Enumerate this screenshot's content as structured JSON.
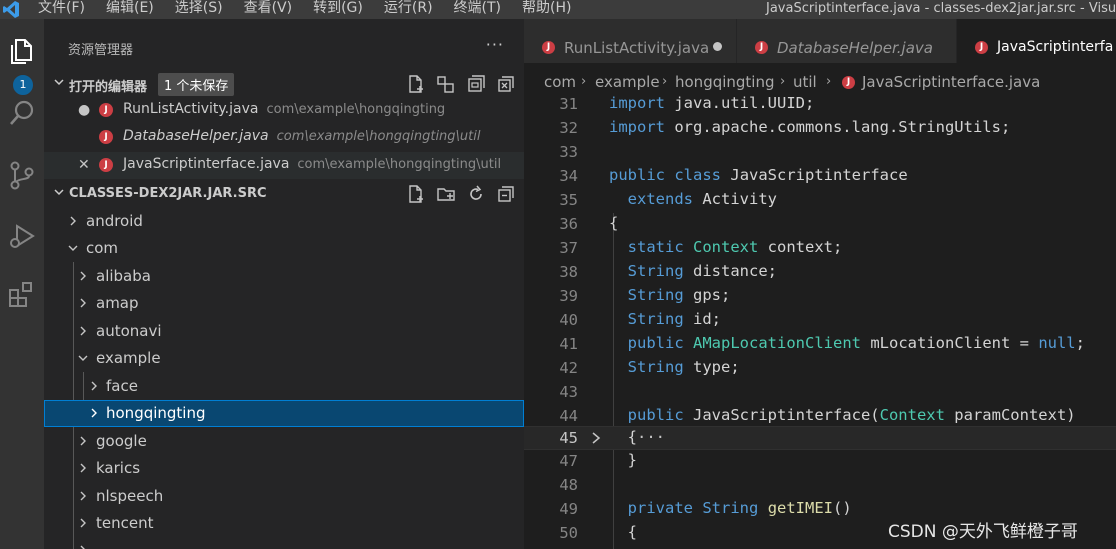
{
  "menu": [
    "文件(F)",
    "编辑(E)",
    "选择(S)",
    "查看(V)",
    "转到(G)",
    "运行(R)",
    "终端(T)",
    "帮助(H)"
  ],
  "window_title": "JavaScriptinterface.java - classes-dex2jar.jar.src - Visu",
  "activity_bar": {
    "explorer_badge": "1"
  },
  "sidebar": {
    "title": "资源管理器",
    "more": "···",
    "open_editors": {
      "label": "打开的编辑器",
      "unsaved_badge": "1 个未保存",
      "items": [
        {
          "name": "RunListActivity.java",
          "path": "com\\example\\hongqingting",
          "state": "●"
        },
        {
          "name": "DatabaseHelper.java",
          "path": "com\\example\\hongqingting\\util",
          "state": ""
        },
        {
          "name": "JavaScriptinterface.java",
          "path": "com\\example\\hongqingting\\util",
          "state": "✕"
        }
      ]
    },
    "project": {
      "label": "CLASSES-DEX2JAR.JAR.SRC",
      "tree": [
        "android",
        "com",
        "alibaba",
        "amap",
        "autonavi",
        "example",
        "face",
        "hongqingting",
        "google",
        "karics",
        "nlspeech",
        "tencent"
      ]
    }
  },
  "tabs": [
    {
      "name": "RunListActivity.java"
    },
    {
      "name": "DatabaseHelper.java"
    },
    {
      "name": "JavaScriptinterfa"
    }
  ],
  "breadcrumbs": [
    "com",
    "example",
    "hongqingting",
    "util",
    "JavaScriptinterface.java"
  ],
  "code": {
    "line_numbers": [
      "31",
      "32",
      "33",
      "34",
      "35",
      "36",
      "37",
      "38",
      "39",
      "40",
      "41",
      "42",
      "43",
      "44",
      "45",
      "47",
      "48",
      "49",
      "50"
    ]
  },
  "watermark": "CSDN @天外飞鲜橙子哥"
}
